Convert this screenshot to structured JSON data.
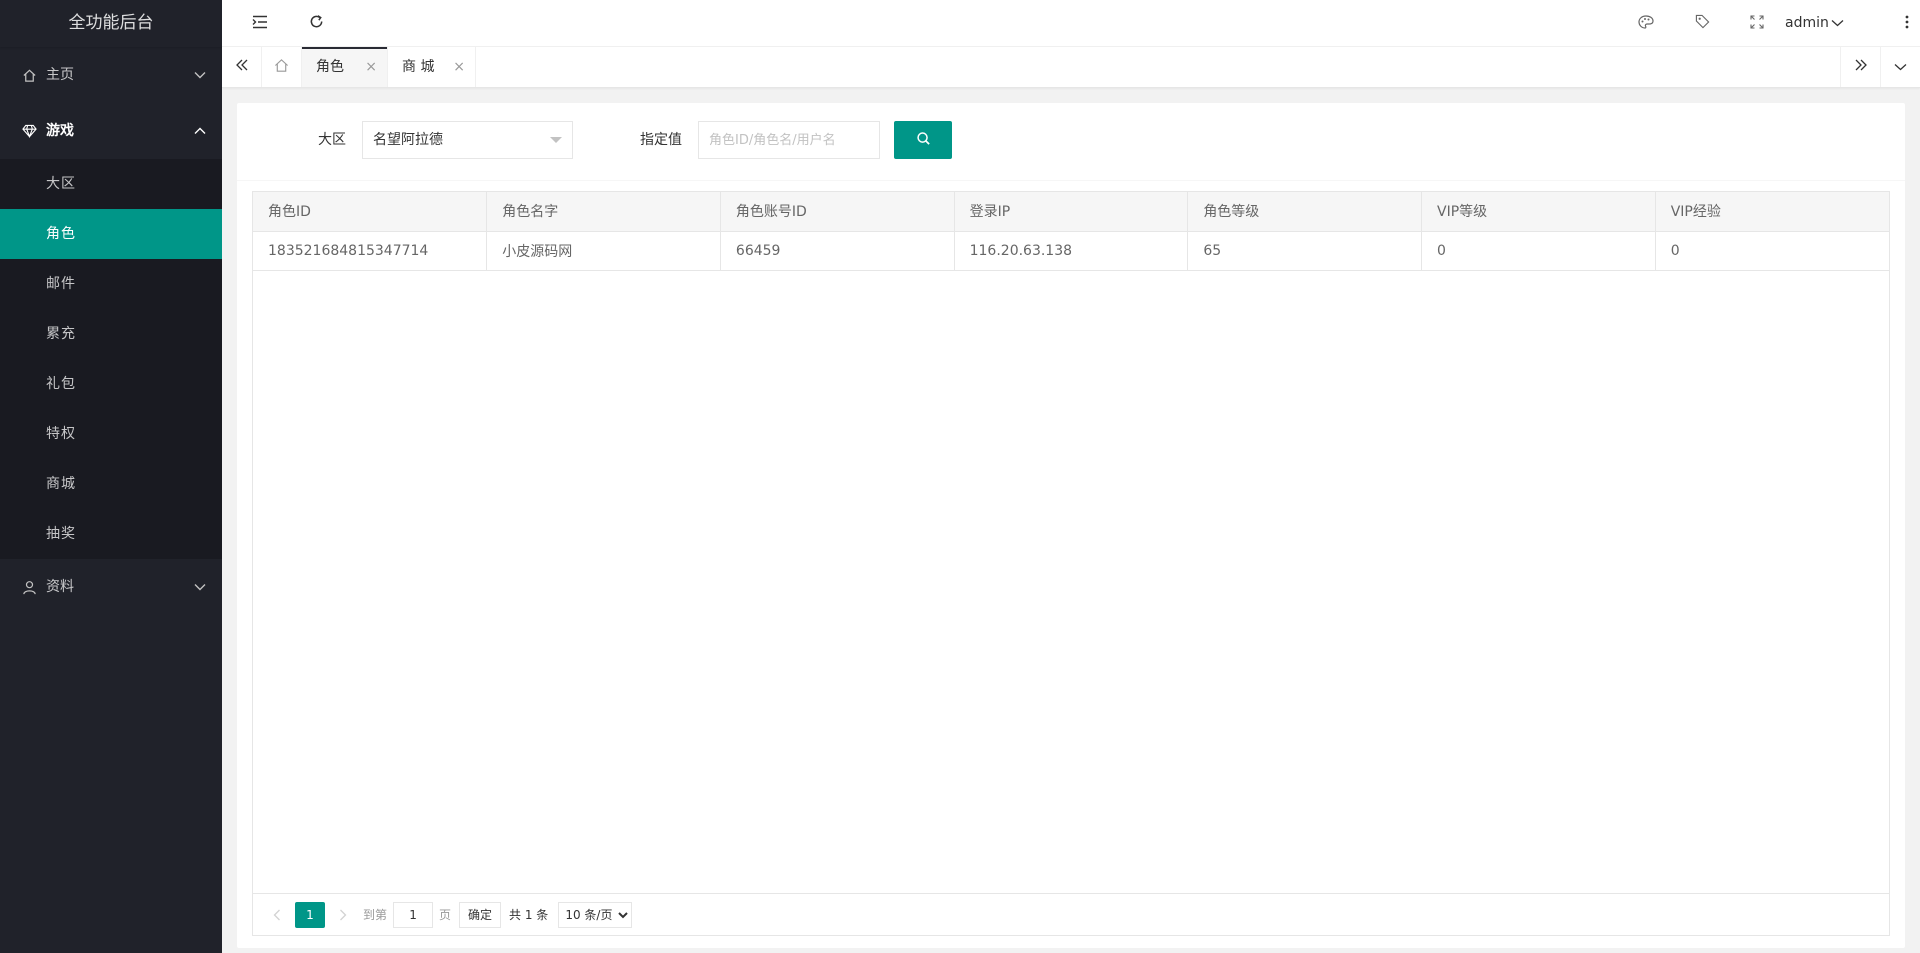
{
  "sidebar": {
    "logo": "全功能后台",
    "groups": [
      {
        "label": "主页",
        "icon": "home-icon",
        "open": false
      },
      {
        "label": "游戏",
        "icon": "diamond-icon",
        "open": true,
        "items": [
          "大区",
          "角色",
          "邮件",
          "累充",
          "礼包",
          "特权",
          "商城",
          "抽奖"
        ],
        "active": "角色"
      },
      {
        "label": "资料",
        "icon": "user-icon",
        "open": false
      }
    ]
  },
  "header": {
    "user": "admin"
  },
  "tabs": [
    {
      "label": "角色",
      "active": true
    },
    {
      "label": "商 城",
      "active": false
    }
  ],
  "search": {
    "region_label": "大区",
    "region_value": "名望阿拉德",
    "value_label": "指定值",
    "value_placeholder": "角色ID/角色名/用户名",
    "value": ""
  },
  "table": {
    "columns": [
      "角色ID",
      "角色名字",
      "角色账号ID",
      "登录IP",
      "角色等级",
      "VIP等级",
      "VIP经验"
    ],
    "rows": [
      [
        "183521684815347714",
        "小皮源码网",
        "66459",
        "116.20.63.138",
        "65",
        "0",
        "0"
      ]
    ]
  },
  "pager": {
    "current": "1",
    "goto_label": "到第",
    "goto_value": "1",
    "page_unit": "页",
    "ok": "确定",
    "total": "共 1 条",
    "page_size": "10 条/页"
  },
  "colors": {
    "accent": "#009688",
    "sidebar_bg": "#20222a",
    "submenu_bg": "#191a21"
  }
}
